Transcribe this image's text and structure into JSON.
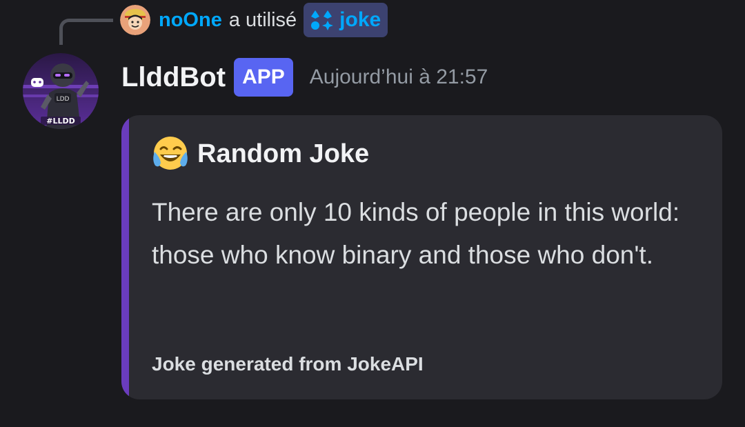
{
  "reply": {
    "username": "noOne",
    "action": "a utilisé",
    "command": "joke",
    "user_color": "#00a8fc",
    "command_bg": "#3c4270"
  },
  "message": {
    "bot_name": "LlddBot",
    "badge": "APP",
    "timestamp": "Aujourd’hui à 21:57",
    "avatar_text": "#LLDD",
    "avatar_robot_text": "LDD"
  },
  "embed": {
    "emoji": "joy-face-emoji",
    "title": "Random Joke",
    "description": "There are only 10 kinds of people in this world: those who know binary and those who don't.",
    "footer": "Joke generated from JokeAPI",
    "accent_color": "#6a3cbd"
  },
  "colors": {
    "background": "#1a1a1e",
    "embed_bg": "#2b2b31",
    "badge_bg": "#5865f2",
    "timestamp": "#949ba4"
  }
}
